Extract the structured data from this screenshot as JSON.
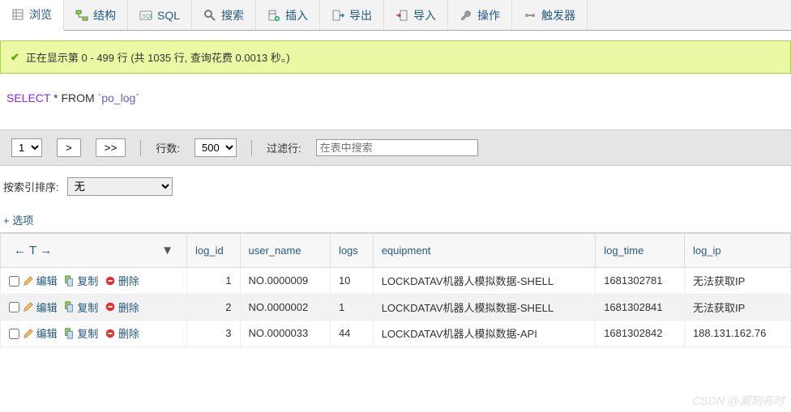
{
  "tabs": {
    "browse": "浏览",
    "structure": "结构",
    "sql": "SQL",
    "search": "搜索",
    "insert": "插入",
    "export": "导出",
    "import": "导入",
    "operations": "操作",
    "triggers": "触发器"
  },
  "status": {
    "text": "正在显示第 0 - 499 行 (共 1035 行, 查询花费 0.0013 秒。)"
  },
  "sql": {
    "select": "SELECT",
    "star_from": " * FROM ",
    "table": "`po_log`"
  },
  "pager": {
    "page_options": [
      "1"
    ],
    "page_value": "1",
    "next": ">",
    "last": ">>",
    "rows_label": "行数:",
    "rows_options": [
      "500"
    ],
    "rows_value": "500",
    "filter_label": "过滤行:",
    "filter_placeholder": "在表中搜索"
  },
  "sort": {
    "label": "按索引排序:",
    "options": [
      "无"
    ],
    "value": "无"
  },
  "options_link": "+ 选项",
  "arrows": {
    "left": "←",
    "t": "T",
    "right": "→",
    "down": "▼"
  },
  "columns": [
    "log_id",
    "user_name",
    "logs",
    "equipment",
    "log_time",
    "log_ip"
  ],
  "ops": {
    "edit": "编辑",
    "copy": "复制",
    "delete": "删除"
  },
  "rows": [
    {
      "log_id": "1",
      "user_name": "NO.0000009",
      "logs": "10",
      "equipment": "LOCKDATAV机器人模拟数据-SHELL",
      "log_time": "1681302781",
      "log_ip": "无法获取IP"
    },
    {
      "log_id": "2",
      "user_name": "NO.0000002",
      "logs": "1",
      "equipment": "LOCKDATAV机器人模拟数据-SHELL",
      "log_time": "1681302841",
      "log_ip": "无法获取IP"
    },
    {
      "log_id": "3",
      "user_name": "NO.0000033",
      "logs": "44",
      "equipment": "LOCKDATAV机器人模拟数据-API",
      "log_time": "1681302842",
      "log_ip": "188.131.162.76"
    }
  ],
  "watermark": "CSDN @漏刻有时"
}
